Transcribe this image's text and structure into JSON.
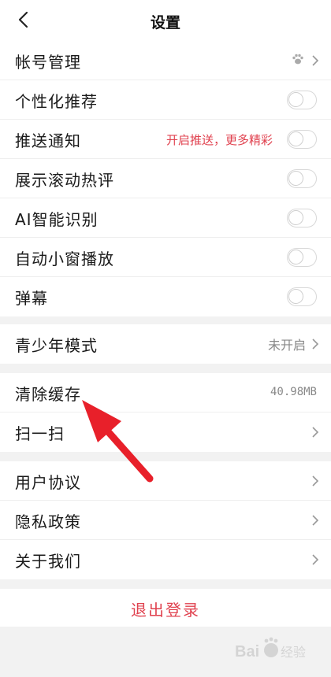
{
  "header": {
    "title": "设置"
  },
  "section1": {
    "account": {
      "label": "帐号管理"
    },
    "personal_recommend": {
      "label": "个性化推荐"
    },
    "push": {
      "label": "推送通知",
      "promo": "开启推送，更多精彩"
    },
    "scroll_comments": {
      "label": "展示滚动热评"
    },
    "ai_recognition": {
      "label": "AI智能识别"
    },
    "mini_window": {
      "label": "自动小窗播放"
    },
    "danmaku": {
      "label": "弹幕"
    }
  },
  "section2": {
    "teen_mode": {
      "label": "青少年模式",
      "value": "未开启"
    }
  },
  "section3": {
    "clear_cache": {
      "label": "清除缓存",
      "value": "40.98MB"
    },
    "scan": {
      "label": "扫一扫"
    }
  },
  "section4": {
    "user_agreement": {
      "label": "用户协议"
    },
    "privacy": {
      "label": "隐私政策"
    },
    "about": {
      "label": "关于我们"
    }
  },
  "logout": {
    "label": "退出登录"
  },
  "colors": {
    "accent": "#e0424f",
    "arrow": "#e8202a",
    "background": "#f2f2f2"
  },
  "icons": [
    "back-arrow-icon",
    "paw-icon",
    "chevron-right-icon",
    "toggle-switch"
  ]
}
